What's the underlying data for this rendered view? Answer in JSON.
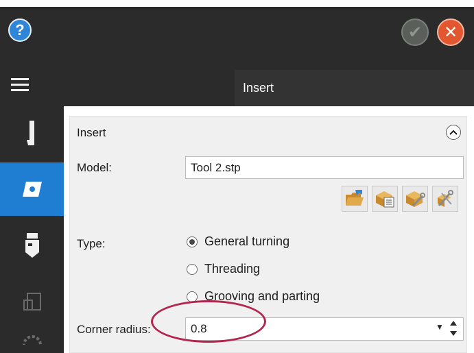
{
  "header": {
    "help_icon": "help-circle-icon",
    "help_glyph": "?",
    "ok_icon": "checkmark-circle-icon",
    "ok_glyph": "✔",
    "close_icon": "close-circle-icon",
    "close_glyph": "✕",
    "menu_icon": "hamburger-menu-icon",
    "tab_title": "Insert"
  },
  "sidebar": {
    "items": [
      {
        "icon": "tool-holder-icon",
        "active": false
      },
      {
        "icon": "insert-icon",
        "active": true
      },
      {
        "icon": "turret-icon",
        "active": false
      },
      {
        "icon": "layout-icon",
        "active": false
      },
      {
        "icon": "gear-icon",
        "active": false
      }
    ]
  },
  "group": {
    "title": "Insert",
    "collapse_icon": "chevron-up-icon",
    "model_label": "Model:",
    "model_value": "Tool 2.stp",
    "tool_buttons": [
      {
        "icon": "open-folder-icon"
      },
      {
        "icon": "box-list-icon"
      },
      {
        "icon": "box-wrench-icon"
      },
      {
        "icon": "wrench-settings-icon"
      }
    ],
    "type_label": "Type:",
    "type_options": [
      {
        "label": "General turning",
        "selected": true
      },
      {
        "label": "Threading",
        "selected": false
      },
      {
        "label": "Grooving and parting",
        "selected": false
      }
    ],
    "corner_label": "Corner radius:",
    "corner_value": "0.8"
  },
  "colors": {
    "dark_bg": "#2b2b2b",
    "active_blue": "#1f7dd2",
    "close_red": "#e2572f",
    "annotation": "#b2264f"
  }
}
